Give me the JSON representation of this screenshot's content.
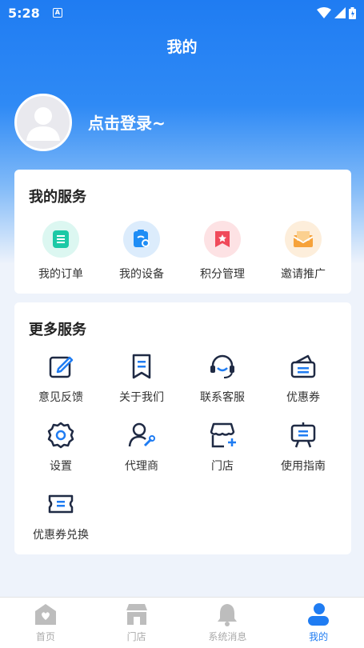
{
  "status_bar": {
    "time": "5:28"
  },
  "header": {
    "title": "我的"
  },
  "profile": {
    "login_prompt": "点击登录~"
  },
  "my_services": {
    "title": "我的服务",
    "items": [
      {
        "label": "我的订单",
        "icon": "order-icon",
        "color": "#1cc9a6",
        "bg": "#dcf7f1"
      },
      {
        "label": "我的设备",
        "icon": "device-icon",
        "color": "#1f8df5",
        "bg": "#dcecfc"
      },
      {
        "label": "积分管理",
        "icon": "points-icon",
        "color": "#f04a5a",
        "bg": "#fde2e4"
      },
      {
        "label": "邀请推广",
        "icon": "invite-icon",
        "color": "#f6a23a",
        "bg": "#fdeedb"
      }
    ]
  },
  "more_services": {
    "title": "更多服务",
    "items": [
      {
        "label": "意见反馈",
        "icon": "feedback-icon"
      },
      {
        "label": "关于我们",
        "icon": "about-icon"
      },
      {
        "label": "联系客服",
        "icon": "headset-icon"
      },
      {
        "label": "优惠券",
        "icon": "coupon-icon"
      },
      {
        "label": "设置",
        "icon": "settings-icon"
      },
      {
        "label": "代理商",
        "icon": "agent-icon"
      },
      {
        "label": "门店",
        "icon": "store-icon"
      },
      {
        "label": "使用指南",
        "icon": "guide-icon"
      },
      {
        "label": "优惠券兑换",
        "icon": "coupon-exchange-icon"
      }
    ]
  },
  "tabbar": {
    "tabs": [
      {
        "label": "首页",
        "icon": "home-icon",
        "active": false
      },
      {
        "label": "门店",
        "icon": "shop-icon",
        "active": false
      },
      {
        "label": "系统消息",
        "icon": "bell-icon",
        "active": false
      },
      {
        "label": "我的",
        "icon": "user-icon",
        "active": true
      }
    ]
  },
  "colors": {
    "primary": "#1f7cf2",
    "icon_dark": "#1f2a44",
    "icon_accent": "#1f7cf2",
    "inactive": "#aaaaaa"
  }
}
